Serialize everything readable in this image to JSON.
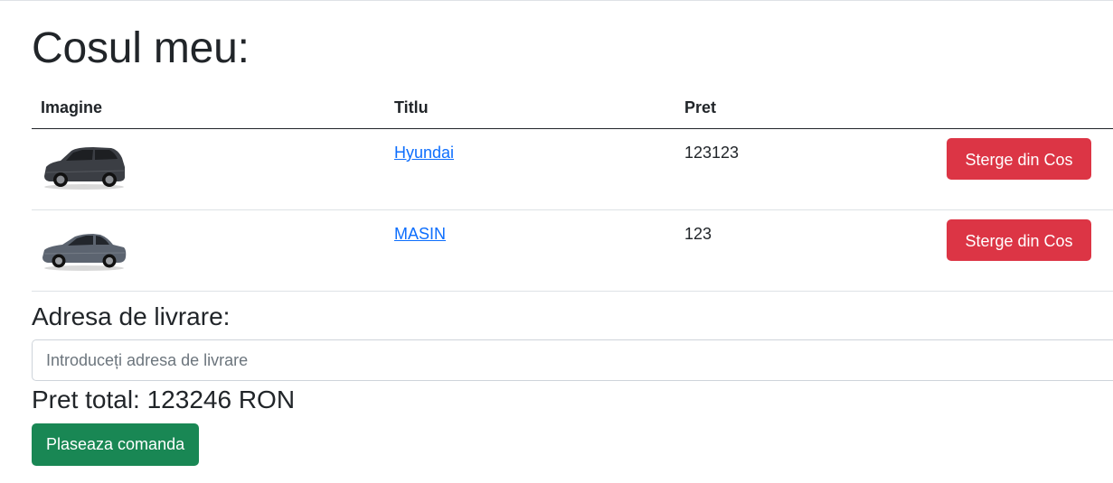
{
  "page": {
    "title": "Cosul meu:"
  },
  "cart_table": {
    "headers": {
      "image": "Imagine",
      "title": "Titlu",
      "price": "Pret"
    },
    "rows": [
      {
        "title": "Hyundai",
        "price": "123123",
        "remove_label": "Sterge din Cos",
        "car_color": "#3b3e44"
      },
      {
        "title": "MASIN",
        "price": "123",
        "remove_label": "Sterge din Cos",
        "car_color": "#5c6470"
      }
    ]
  },
  "delivery": {
    "heading": "Adresa de livrare:",
    "placeholder": "Introduceți adresa de livrare",
    "value": ""
  },
  "total": {
    "text": "Pret total: 123246 RON"
  },
  "order_button": {
    "label": "Plaseaza comanda"
  },
  "colors": {
    "danger": "#dc3545",
    "success": "#198754",
    "link": "#0d6efd"
  }
}
